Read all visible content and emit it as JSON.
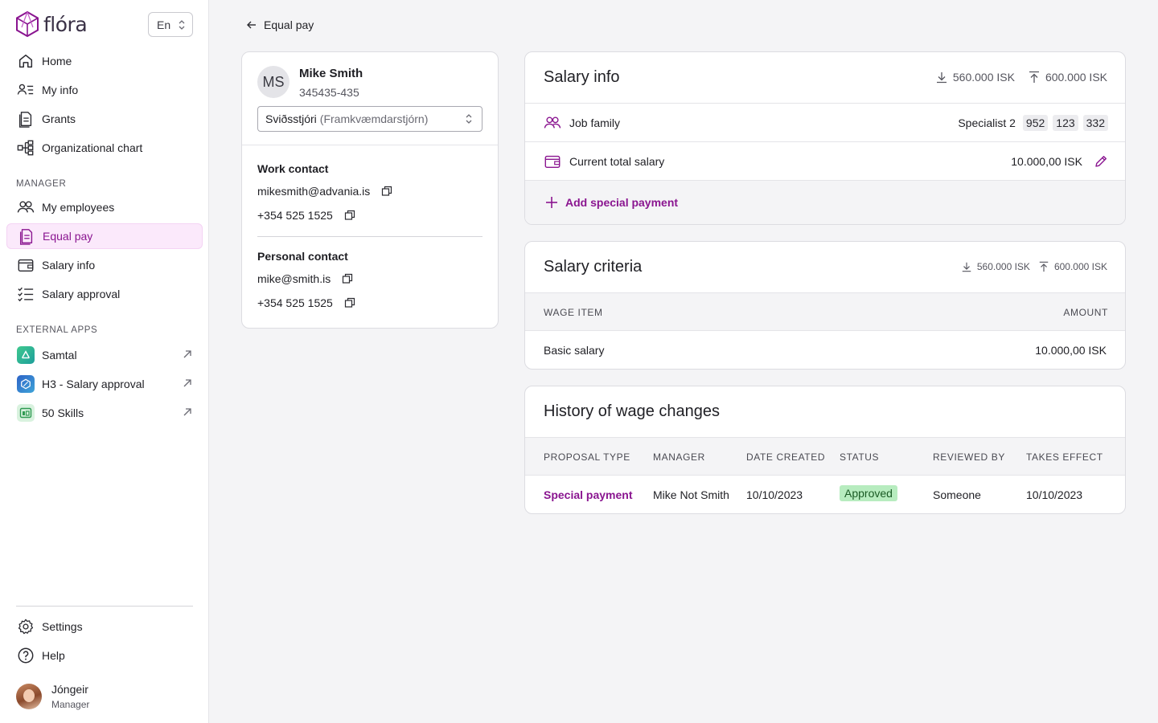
{
  "brand": {
    "name": "flóra",
    "accent": "#8a1590"
  },
  "language": {
    "value": "En"
  },
  "nav": {
    "main": [
      {
        "label": "Home",
        "icon": "home-icon"
      },
      {
        "label": "My info",
        "icon": "person-list-icon"
      },
      {
        "label": "Grants",
        "icon": "document-icon"
      },
      {
        "label": "Organizational chart",
        "icon": "org-chart-icon"
      }
    ],
    "manager_label": "MANAGER",
    "manager": [
      {
        "label": "My employees",
        "icon": "people-icon"
      },
      {
        "label": "Equal pay",
        "icon": "document-icon",
        "active": true
      },
      {
        "label": "Salary info",
        "icon": "wallet-icon"
      },
      {
        "label": "Salary approval",
        "icon": "checklist-icon"
      }
    ],
    "external_label": "EXTERNAL APPS",
    "external": [
      {
        "label": "Samtal",
        "icon": "samtal-app-icon"
      },
      {
        "label": "H3 - Salary approval",
        "icon": "h3-app-icon"
      },
      {
        "label": "50 Skills",
        "icon": "50skills-app-icon"
      }
    ],
    "bottom": [
      {
        "label": "Settings",
        "icon": "gear-icon"
      },
      {
        "label": "Help",
        "icon": "help-icon"
      }
    ]
  },
  "user": {
    "name": "Jóngeir",
    "role": "Manager"
  },
  "back": {
    "label": "Equal pay"
  },
  "profile": {
    "initials": "MS",
    "name": "Mike Smith",
    "id": "345435-435",
    "role_primary": "Sviðsstjóri",
    "role_secondary": "(Framkvæmdarstjórn)",
    "work_title": "Work contact",
    "work_email": "mikesmith@advania.is",
    "work_phone": "+354 525 1525",
    "personal_title": "Personal contact",
    "personal_email": "mike@smith.is",
    "personal_phone": "+354 525 1525"
  },
  "salary_info": {
    "title": "Salary info",
    "min": "560.000 ISK",
    "max": "600.000 ISK",
    "job_family_label": "Job family",
    "job_family_value": "Specialist 2",
    "job_family_codes": [
      "952",
      "123",
      "332"
    ],
    "current_label": "Current total salary",
    "current_value": "10.000,00 ISK",
    "add_label": "Add special payment"
  },
  "criteria": {
    "title": "Salary criteria",
    "min": "560.000 ISK",
    "max": "600.000 ISK",
    "columns": [
      "WAGE ITEM",
      "AMOUNT"
    ],
    "rows": [
      {
        "item": "Basic salary",
        "amount": "10.000,00 ISK"
      }
    ]
  },
  "history": {
    "title": "History of wage changes",
    "columns": [
      "PROPOSAL TYPE",
      "MANAGER",
      "DATE CREATED",
      "STATUS",
      "REVIEWED BY",
      "TAKES EFFECT"
    ],
    "rows": [
      {
        "type": "Special payment",
        "manager": "Mike Not Smith",
        "created": "10/10/2023",
        "status": "Approved",
        "reviewed_by": "Someone",
        "effect": "10/10/2023"
      }
    ]
  }
}
